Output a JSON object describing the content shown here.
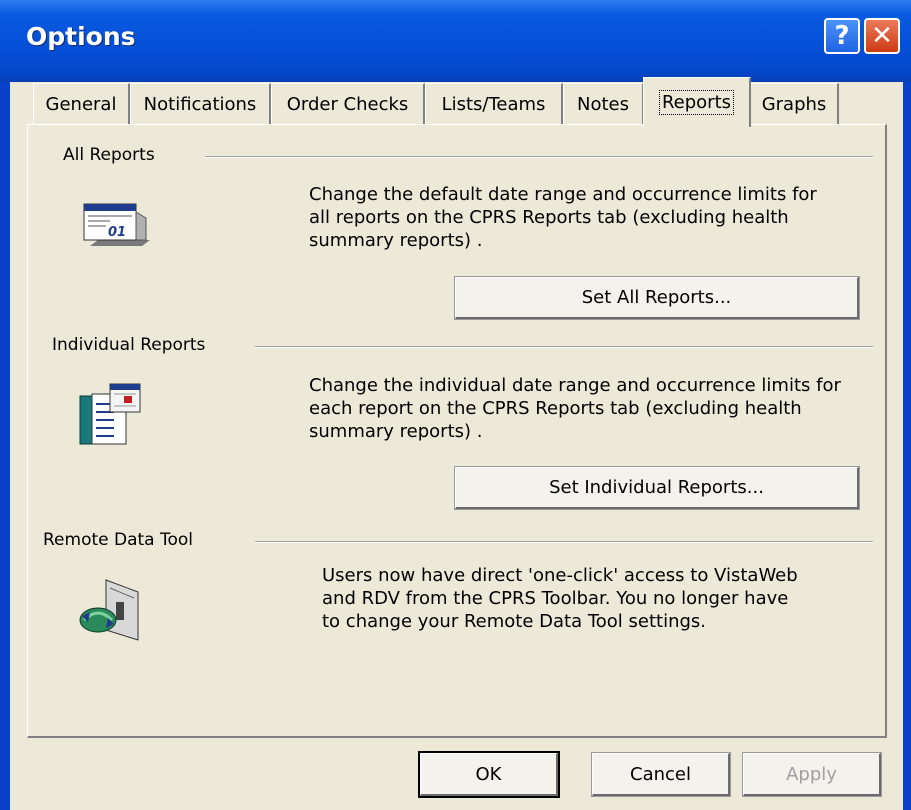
{
  "window": {
    "title": "Options"
  },
  "titlebar": {
    "help_glyph": "?",
    "close_glyph": "✕"
  },
  "tabs": [
    {
      "label": "General"
    },
    {
      "label": "Notifications"
    },
    {
      "label": "Order Checks"
    },
    {
      "label": "Lists/Teams"
    },
    {
      "label": "Notes"
    },
    {
      "label": "Reports",
      "active": true
    },
    {
      "label": "Graphs"
    }
  ],
  "sections": {
    "all_reports": {
      "heading": "All Reports",
      "description": [
        "Change the default date range and occurrence limits for",
        "all reports on the CPRS Reports tab (excluding health",
        "summary reports) ."
      ],
      "button": "Set All Reports...",
      "icon": "calendar-report-icon"
    },
    "individual_reports": {
      "heading": "Individual Reports",
      "description": [
        "Change the individual date range and occurrence limits for",
        "each report on the CPRS Reports tab (excluding health",
        "summary reports) ."
      ],
      "button": "Set Individual Reports...",
      "icon": "individual-report-icon"
    },
    "remote_data_tool": {
      "heading": "Remote Data Tool",
      "description": [
        "Users now have direct 'one-click' access to VistaWeb",
        "and RDV from the CPRS Toolbar.  You no longer have",
        "to change your Remote Data Tool settings."
      ],
      "icon": "remote-data-icon"
    }
  },
  "footer": {
    "ok_label": "OK",
    "cancel_label": "Cancel",
    "apply_label": "Apply"
  },
  "colors": {
    "titlebar": "#0550d8",
    "dialog_face": "#ece9d8",
    "close_button": "#cc3a14"
  }
}
